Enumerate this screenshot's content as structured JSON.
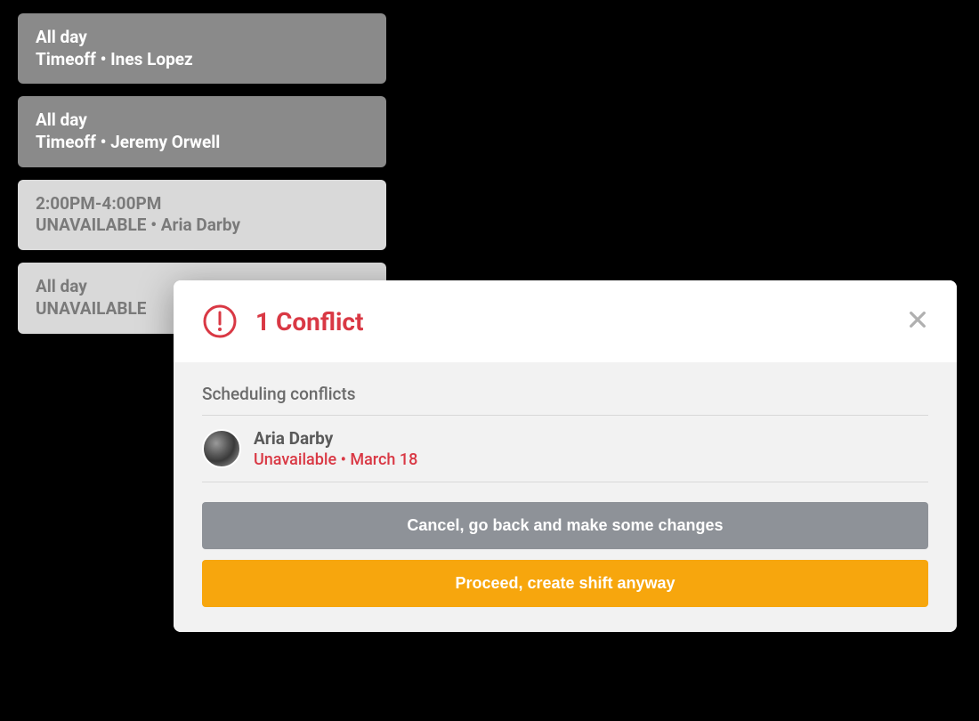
{
  "schedule": {
    "cards": [
      {
        "time": "All day",
        "detail": "Timeoff • Ines Lopez",
        "variant": "dark"
      },
      {
        "time": "All day",
        "detail": "Timeoff • Jeremy Orwell",
        "variant": "dark"
      },
      {
        "time": "2:00PM-4:00PM",
        "detail": "UNAVAILABLE • Aria Darby",
        "variant": "light"
      },
      {
        "time": "All day",
        "detail": "UNAVAILABLE",
        "variant": "light"
      }
    ]
  },
  "dialog": {
    "title": "1 Conflict",
    "section_title": "Scheduling conflicts",
    "conflicts": [
      {
        "name": "Aria Darby",
        "reason": "Unavailable • March 18"
      }
    ],
    "actions": {
      "cancel_label": "Cancel, go back and make some changes",
      "proceed_label": "Proceed, create shift anyway"
    }
  },
  "colors": {
    "accent": "#d93844",
    "proceed": "#f7a60d",
    "cancel": "#8e9298"
  }
}
